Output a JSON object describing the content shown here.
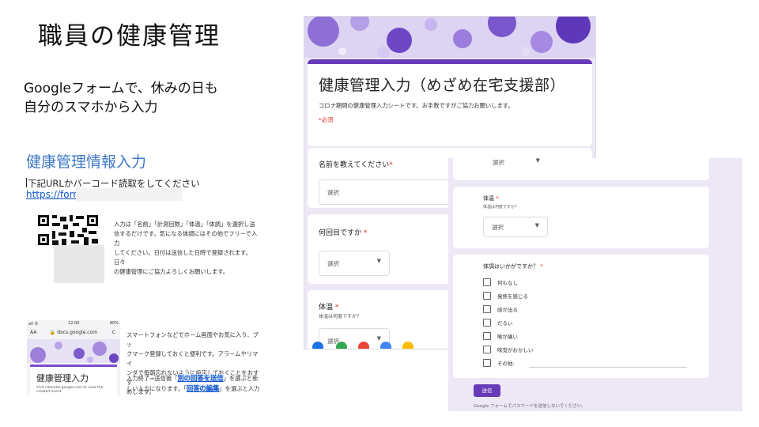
{
  "slide": {
    "title": "職員の健康管理",
    "subtitle_line1": "Googleフォームで、休みの日も",
    "subtitle_line2": "自分のスマホから入力"
  },
  "doc": {
    "title": "健康管理情報入力",
    "instruction": "下記URLかバーコード読取をしてください",
    "link": "https://form",
    "para_line1": "入力は「名前」「計測回数」「体温」「体調」を選択し送",
    "para_line2": "信するだけです。気になる体調にはその他でフリーで入力",
    "para_line3": "してください。日付は送信した日時で登録されます。日々",
    "para_line4": "の健康管理にご協力よろしくお願いします。",
    "phone_para1_line1": "スマートフォンなどでホーム画面やお気に入り、ブッ",
    "phone_para1_line2": "クマーク登録しておくと便利です。アラームやリマイ",
    "phone_para1_line3": "ンダで毎朝忘れないように設定しておくことをおすす",
    "phone_para1_line4": "めします。",
    "phone_para2_pre": "入力終了⇒送信後「",
    "phone_para2_link1": "別の回答を送信",
    "phone_para2_mid": "」を選ぶと新",
    "phone_para2_line2_pre": "しい入力になります。「",
    "phone_para2_link2": "回答の編集",
    "phone_para2_post": "」を選ぶと入力"
  },
  "phone": {
    "status_left": "all 令",
    "status_time": "12:00",
    "status_right": "80%",
    "url_aa": "AA",
    "url": "docs.google.com",
    "reload": "C",
    "card_title": "健康管理入力",
    "card_text_line1": "Visit calendar.google.com to view the",
    "card_text_line2": "created event."
  },
  "form1": {
    "title": "健康管理入力（めざめ在宅支援部）",
    "description": "コロナ期間の健康管理入力シートです。お手数ですがご協力お願いします。",
    "required_note": "*必須",
    "q1_label": "名前を教えてください",
    "q1_select": "選択",
    "q2_label": "何回目ですか",
    "q2_select": "選択",
    "q3_label": "体温",
    "q3_note": "体温は何度ですか？",
    "q3_select": "選択",
    "req_mark": "*"
  },
  "form2": {
    "top_select": "選択",
    "temp_label": "体温",
    "temp_note": "体温は何度ですか？",
    "temp_select": "選択",
    "condition_label": "体調はいかがですか？",
    "req_mark": "*",
    "options": [
      "何もなし",
      "発熱を感じる",
      "咳が出る",
      "だるい",
      "喉が痛い",
      "味覚がおかしい",
      "その他:"
    ],
    "submit": "送信",
    "footnote": "Google フォームでパスワードを送信しないでください。"
  },
  "icons": {
    "dropdown": "dropdown-arrow-icon",
    "checkbox": "checkbox-icon",
    "lock": "lock-icon",
    "qr": "qr-code-icon"
  },
  "colors": {
    "accent": "#673ab7",
    "form_bg": "#ede7f6",
    "link": "#1155cc",
    "doc_title": "#3c78c6",
    "required": "#d93025"
  }
}
